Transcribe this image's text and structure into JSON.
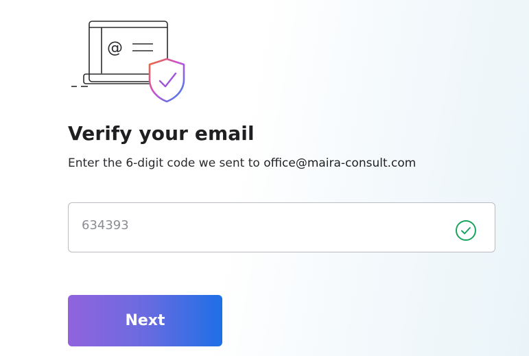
{
  "verify": {
    "title": "Verify your email",
    "subtitle_prefix": "Enter the 6-digit code we sent to ",
    "email": "office@maira-consult.com"
  },
  "code_field": {
    "value": "634393",
    "status_icon": "check-circle-icon",
    "status_color": "#1aa260"
  },
  "next_button": {
    "label": "Next",
    "gradient_start": "#9163dd",
    "gradient_end": "#1e6fe6"
  },
  "illustration": {
    "laptop_icon": "laptop-icon",
    "at_symbol": "@",
    "shield_icon": "shield-check-icon"
  }
}
